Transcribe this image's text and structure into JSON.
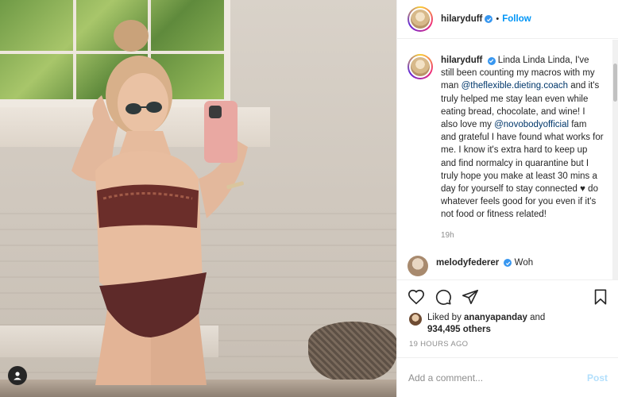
{
  "post": {
    "username": "hilaryduff",
    "follow_label": "Follow",
    "separator": "•",
    "caption": {
      "username": "hilaryduff",
      "part1": "Linda Linda Linda, I've still been counting my macros with my man ",
      "mention1": "@theflexible.dieting.coach",
      "part2": " and it's truly helped me stay lean even while eating bread, chocolate, and wine! I also love my ",
      "mention2": "@novobodyofficial",
      "part3": " fam and grateful I have found what works for me. I know it's extra hard to keep up and find normalcy in quarantine but I truly hope you make at least 30 mins a day for yourself to stay connected ♥ do whatever feels good for you even if it's not food or fitness related!",
      "time": "19h"
    },
    "next_comment": {
      "username": "melodyfederer",
      "text": "Woh"
    },
    "likes": {
      "prefix": "Liked by ",
      "user": "ananyapanday",
      "middle": " and",
      "count": "934,495",
      "suffix": " others"
    },
    "timestamp": "19 HOURS AGO",
    "add_comment_placeholder": "Add a comment...",
    "post_label": "Post"
  },
  "icons": {
    "verified": "verified-badge-icon",
    "like": "heart-icon",
    "comment": "comment-icon",
    "share": "share-icon",
    "save": "bookmark-icon",
    "tagged_user": "user-icon"
  },
  "colors": {
    "accent": "#0095f6",
    "verified": "#3897f0",
    "mention": "#00376b",
    "muted": "#8e8e8e",
    "post_disabled": "#b2dffc"
  }
}
